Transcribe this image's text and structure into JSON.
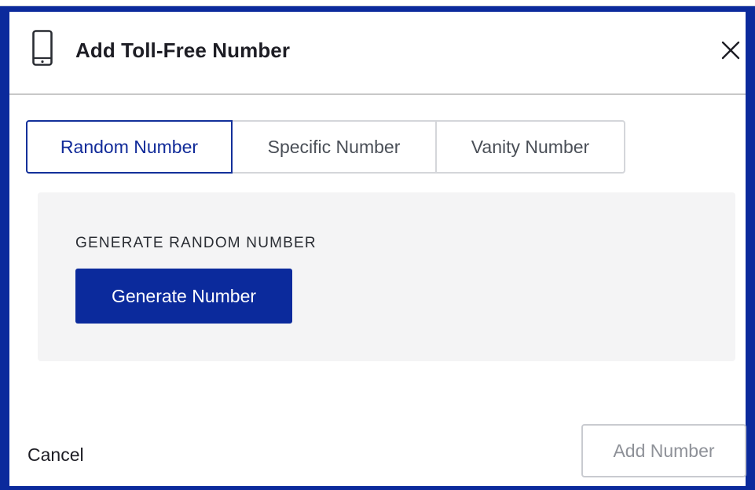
{
  "dialog": {
    "title": "Add Toll-Free Number",
    "title_icon": "mobile-phone-icon",
    "close_icon": "close-icon"
  },
  "tabs": [
    {
      "label": "Random Number",
      "active": true
    },
    {
      "label": "Specific Number",
      "active": false
    },
    {
      "label": "Vanity Number",
      "active": false
    }
  ],
  "panel": {
    "heading": "GENERATE RANDOM NUMBER",
    "generate_label": "Generate Number"
  },
  "footer": {
    "cancel_label": "Cancel",
    "add_label": "Add Number",
    "add_enabled": false
  },
  "colors": {
    "accent": "#0b2a9c",
    "panel_background": "#f4f4f5",
    "disabled_text": "#8e9198"
  }
}
